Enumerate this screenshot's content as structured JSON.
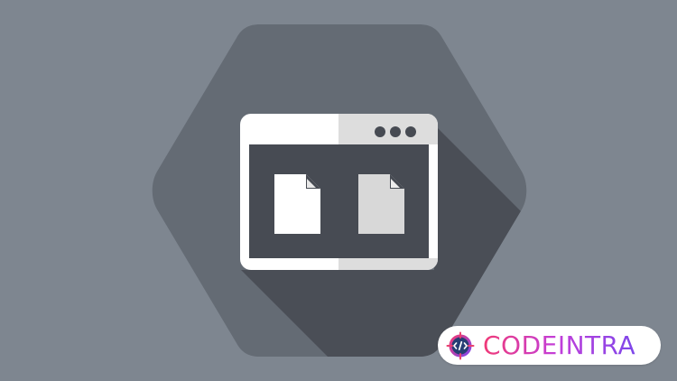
{
  "brand": {
    "name": "CODEINTRA"
  },
  "icons": {
    "main": "browser-window-icon",
    "documents": [
      "document-icon",
      "document-icon"
    ],
    "logo": "code-crosshair-icon"
  },
  "colors": {
    "background": "#7e8690",
    "hexagon": "#646b74",
    "shadow": "#4a4e56",
    "window_frame": "#ffffff",
    "window_content": "#474b53",
    "titlebar_right": "#dddddd",
    "document_primary": "#ffffff",
    "document_secondary": "#d8d8d8",
    "brand_start": "#f03a77",
    "brand_end": "#7d47ea"
  }
}
